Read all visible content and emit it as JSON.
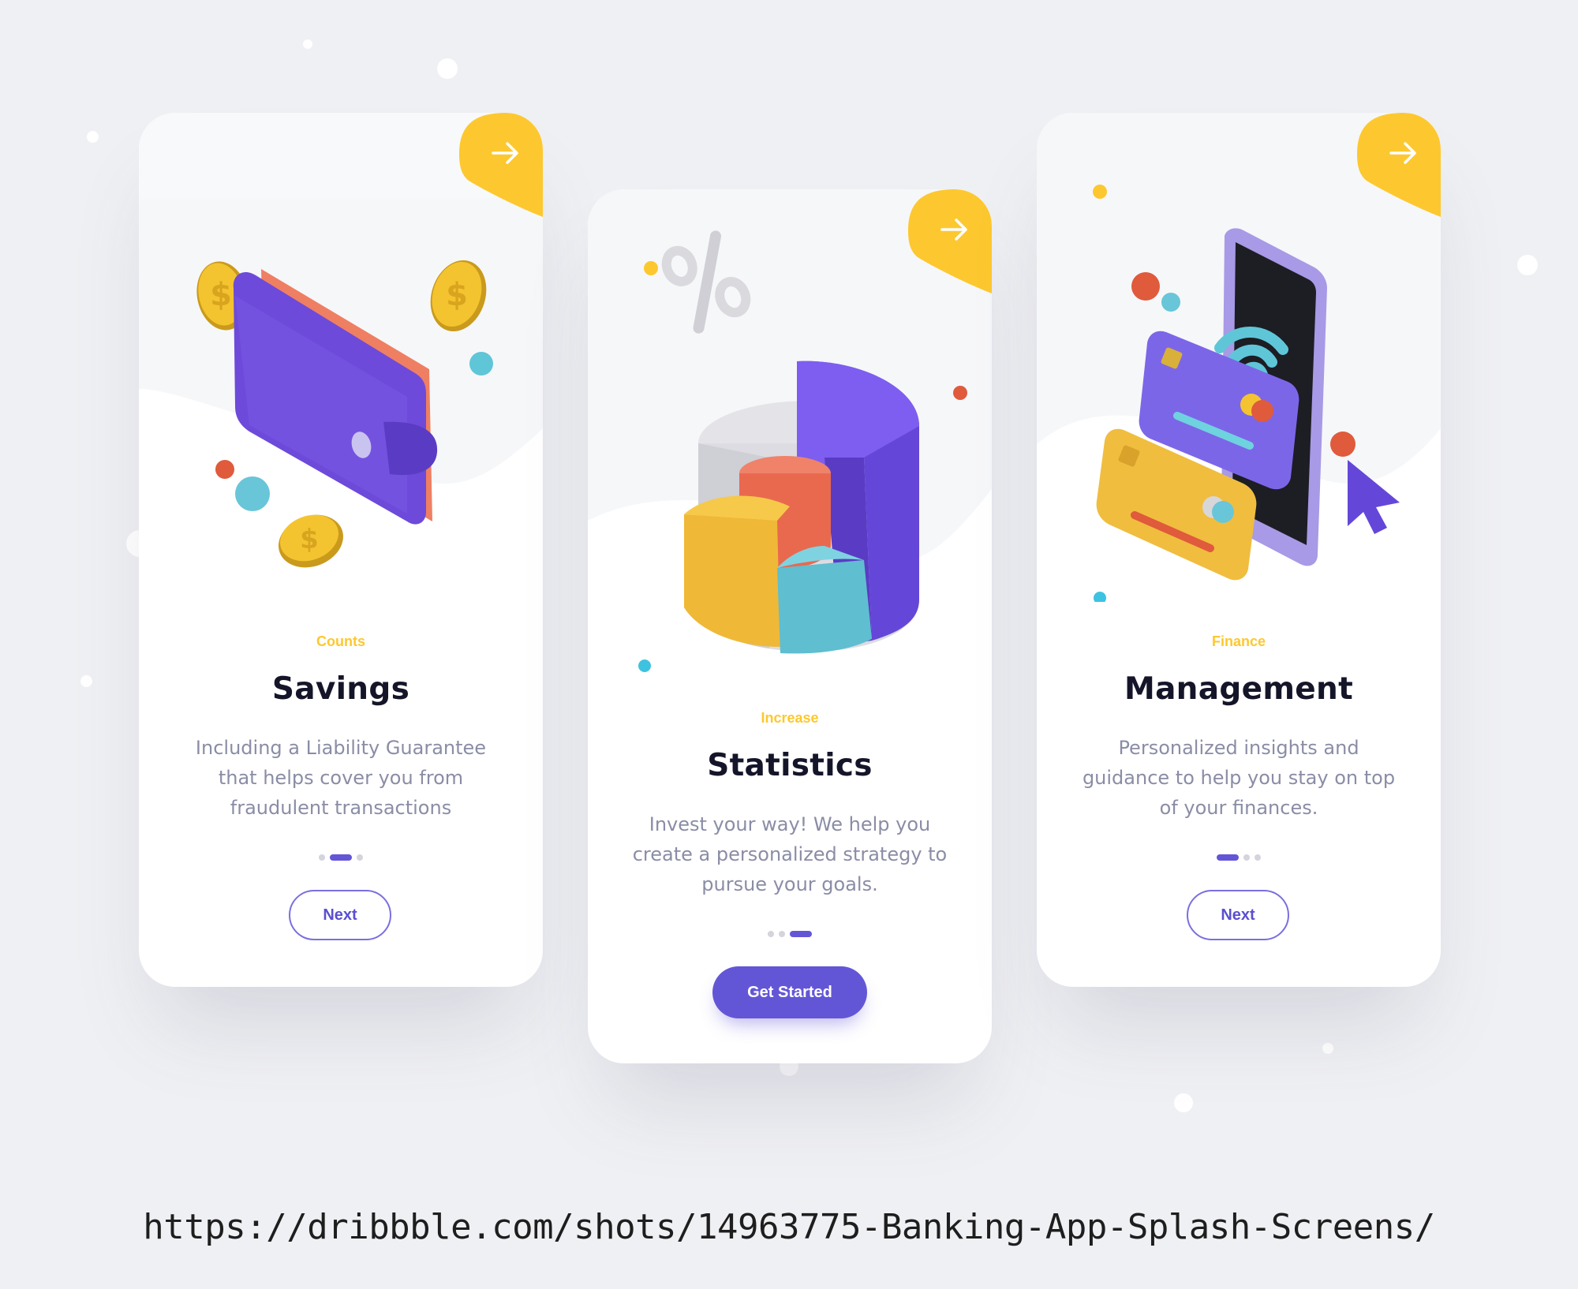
{
  "cards": [
    {
      "eyebrow": "Counts",
      "title": "Savings",
      "description": "Including a Liability Guarantee that helps cover you from fraudulent transactions",
      "button": "Next",
      "active_page": 2,
      "page_count": 3,
      "illustration": "wallet-icon"
    },
    {
      "eyebrow": "Increase",
      "title": "Statistics",
      "description": "Invest your way! We help you create a personalized strategy to pursue your goals.",
      "button": "Get Started",
      "active_page": 3,
      "page_count": 3,
      "illustration": "pie-chart-icon"
    },
    {
      "eyebrow": "Finance",
      "title": "Management",
      "description": "Personalized insights and guidance to help you stay on top of your finances.",
      "button": "Next",
      "active_page": 1,
      "page_count": 3,
      "illustration": "phone-cards-icon"
    }
  ],
  "corner_button_icon": "arrow-right-icon",
  "caption": "https://dribbble.com/shots/14963775-Banking-App-Splash-Screens/",
  "colors": {
    "background": "#eff0f3",
    "accent_yellow": "#fdc82f",
    "primary_purple": "#6356d6",
    "title_text": "#15152a",
    "body_text": "#8a8da5"
  }
}
